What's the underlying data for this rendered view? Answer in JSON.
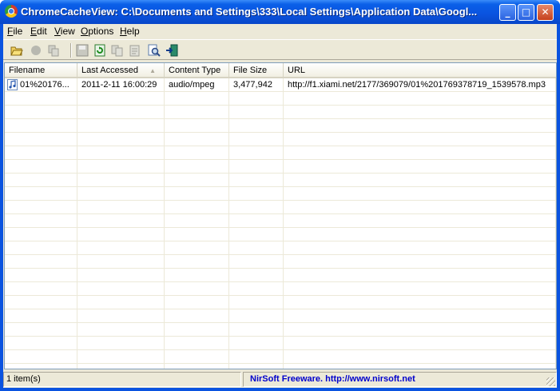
{
  "window": {
    "title": "ChromeCacheView:   C:\\Documents and Settings\\333\\Local Settings\\Application Data\\Googl...",
    "controls": {
      "minimize": "_",
      "maximize": "□",
      "close": "✕"
    }
  },
  "menu": [
    {
      "label": "File",
      "underline": "F",
      "rest": "ile"
    },
    {
      "label": "Edit",
      "underline": "E",
      "rest": "dit"
    },
    {
      "label": "View",
      "underline": "V",
      "rest": "iew"
    },
    {
      "label": "Options",
      "underline": "O",
      "rest": "ptions"
    },
    {
      "label": "Help",
      "underline": "H",
      "rest": "elp"
    }
  ],
  "toolbar": {
    "icons": [
      "open-folder-icon",
      "stop-icon",
      "copy-files-icon",
      "save-icon",
      "refresh-icon",
      "copy-icon",
      "properties-icon",
      "find-icon",
      "exit-icon"
    ]
  },
  "table": {
    "columns": [
      "Filename",
      "Last Accessed",
      "Content Type",
      "File Size",
      "URL"
    ],
    "sorted_column": "Last Accessed",
    "rows": [
      {
        "filename": "01%20176...",
        "last_accessed": "2011-2-11 16:00:29",
        "content_type": "audio/mpeg",
        "file_size": "3,477,942",
        "url": "http://f1.xiami.net/2177/369079/01%201769378719_1539578.mp3"
      }
    ]
  },
  "status": {
    "count": "1 item(s)",
    "freeware": "NirSoft Freeware.  http://www.nirsoft.net"
  }
}
